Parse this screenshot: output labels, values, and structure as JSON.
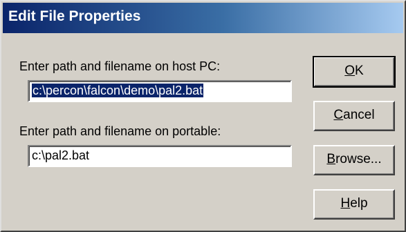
{
  "window": {
    "title": "Edit File Properties"
  },
  "form": {
    "host_label": "Enter path and filename on host PC:",
    "host_value": "c:\\percon\\falcon\\demo\\pal2.bat",
    "portable_label": "Enter path and filename on portable:",
    "portable_value": "c:\\pal2.bat"
  },
  "buttons": {
    "ok": {
      "mnemonic": "O",
      "rest": "K"
    },
    "cancel": {
      "mnemonic": "C",
      "rest": "ancel"
    },
    "browse": {
      "mnemonic": "B",
      "rest": "rowse..."
    },
    "help": {
      "mnemonic": "H",
      "rest": "elp"
    }
  },
  "colors": {
    "title_bar_start": "#0a246a",
    "title_bar_end": "#a6caf0",
    "dialog_face": "#d4d0c8",
    "selection": "#0a246a"
  }
}
